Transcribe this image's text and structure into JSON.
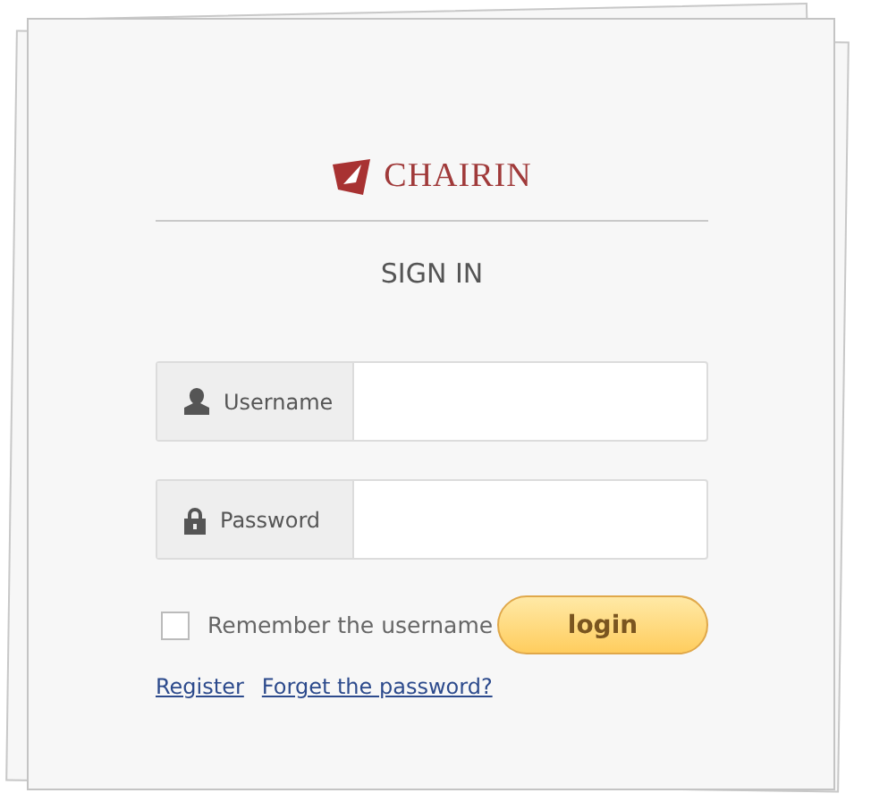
{
  "logo": {
    "text": "CHAIRIN"
  },
  "heading": "SIGN IN",
  "fields": [
    {
      "kind": "user",
      "label": "Username"
    },
    {
      "kind": "lock",
      "label": "Password"
    }
  ],
  "remember": {
    "label": "Remember the username",
    "checked": false
  },
  "login_button": "login",
  "links": [
    "Register",
    "Forget the password?"
  ]
}
